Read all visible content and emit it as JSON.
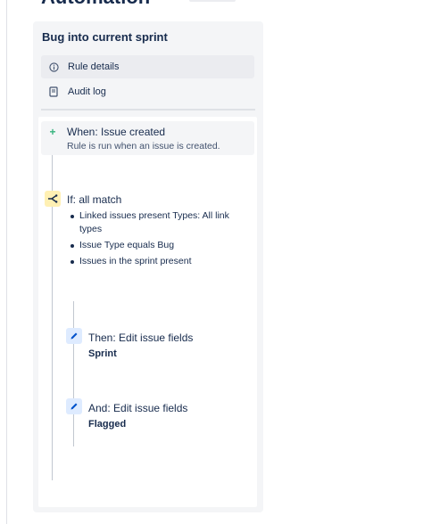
{
  "page": {
    "title": "Automation"
  },
  "rule": {
    "name": "Bug into current sprint"
  },
  "nav": [
    {
      "label": "Rule details",
      "icon": "info-icon",
      "active": true
    },
    {
      "label": "Audit log",
      "icon": "document-icon",
      "active": false
    }
  ],
  "trigger": {
    "title": "When: Issue created",
    "description": "Rule is run when an issue is created.",
    "icon": "plus-icon",
    "color": "#36b37e"
  },
  "condition": {
    "title": "If: all match",
    "icon": "branch-icon",
    "color": "#fff0b3",
    "items": [
      "Linked issues present Types: All link types",
      "Issue Type equals Bug",
      "Issues in the sprint present"
    ]
  },
  "actions": [
    {
      "title": "Then: Edit issue fields",
      "field": "Sprint",
      "icon": "pencil-icon"
    },
    {
      "title": "And: Edit issue fields",
      "field": "Flagged",
      "icon": "pencil-icon"
    }
  ],
  "colors": {
    "panel": "#f4f5f7",
    "action_icon_bg": "#deebff",
    "action_icon_fg": "#0052cc"
  }
}
